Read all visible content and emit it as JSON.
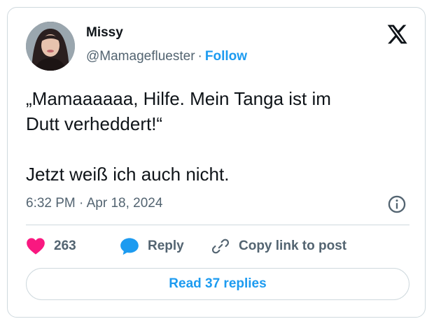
{
  "author": {
    "name": "Missy",
    "handle": "@Mamagefluester",
    "separator": "·",
    "follow_label": "Follow"
  },
  "tweet": {
    "text": "„Mamaaaaaa, Hilfe. Mein Tanga ist im\nDutt verheddert!“\n\nJetzt weiß ich auch nicht.",
    "timestamp": "6:32 PM · Apr 18, 2024"
  },
  "actions": {
    "like_count": "263",
    "reply_label": "Reply",
    "copy_link_label": "Copy link to post"
  },
  "footer": {
    "read_replies_label": "Read 37 replies"
  },
  "colors": {
    "accent": "#1d9bf0",
    "like": "#f91880",
    "muted": "#536471",
    "text": "#0f1419",
    "border": "#cfd9de"
  },
  "icons": [
    "x-logo-icon",
    "info-icon",
    "heart-icon",
    "reply-bubble-icon",
    "link-icon"
  ]
}
